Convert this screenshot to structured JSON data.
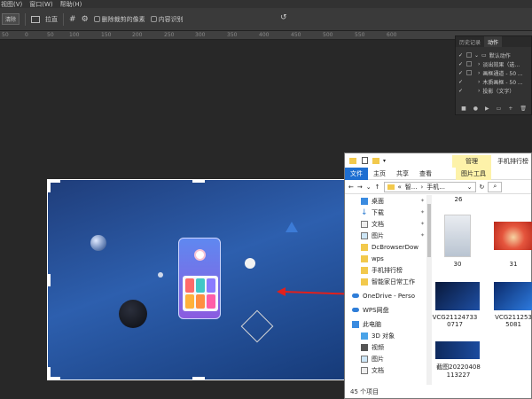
{
  "menubar": [
    "视图(V)",
    "窗口(W)",
    "帮助(H)"
  ],
  "options": {
    "clear_label": "清除",
    "straighten_label": "拉直",
    "delete_cropped_label": "删除裁剪的像素",
    "content_aware_label": "内容识别"
  },
  "ruler_ticks": [
    "50",
    "0",
    "50",
    "100",
    "150",
    "200",
    "250",
    "300",
    "350",
    "400",
    "450",
    "500",
    "550",
    "600"
  ],
  "history_panel": {
    "tabs": [
      "历史记录",
      "动作"
    ],
    "rows": [
      "默认动作",
      "淡出效果（选...",
      "画框通道 - 50 ...",
      "木质画框 - 50 ...",
      "投影（文字）"
    ]
  },
  "explorer": {
    "manage_label": "管理",
    "window_title": "手机排行榜",
    "ribbon_tabs": [
      "文件",
      "主页",
      "共享",
      "查看",
      "图片工具"
    ],
    "address": {
      "crumb1": "智...",
      "crumb2": "手机..."
    },
    "nav_items": [
      {
        "label": "桌面",
        "pinned": true
      },
      {
        "label": "下载",
        "pinned": true
      },
      {
        "label": "文档",
        "pinned": true
      },
      {
        "label": "图片",
        "pinned": true
      },
      {
        "label": "DcBrowserDow",
        "pinned": false
      },
      {
        "label": "wps",
        "pinned": false
      },
      {
        "label": "手机排行榜",
        "pinned": false
      },
      {
        "label": "智能家日常工作",
        "pinned": false
      }
    ],
    "nav_section2": [
      {
        "label": "OneDrive - Perso"
      },
      {
        "label": "WPS网盘"
      },
      {
        "label": "此电脑"
      },
      {
        "label": "3D 对象"
      },
      {
        "label": "视频"
      },
      {
        "label": "图片"
      },
      {
        "label": "文档"
      }
    ],
    "files": {
      "top_caption": "26",
      "items": [
        "30",
        "31",
        "VCG211247330717",
        "VCG2112535081",
        "截图20220408113227"
      ]
    },
    "status": "45 个项目"
  }
}
